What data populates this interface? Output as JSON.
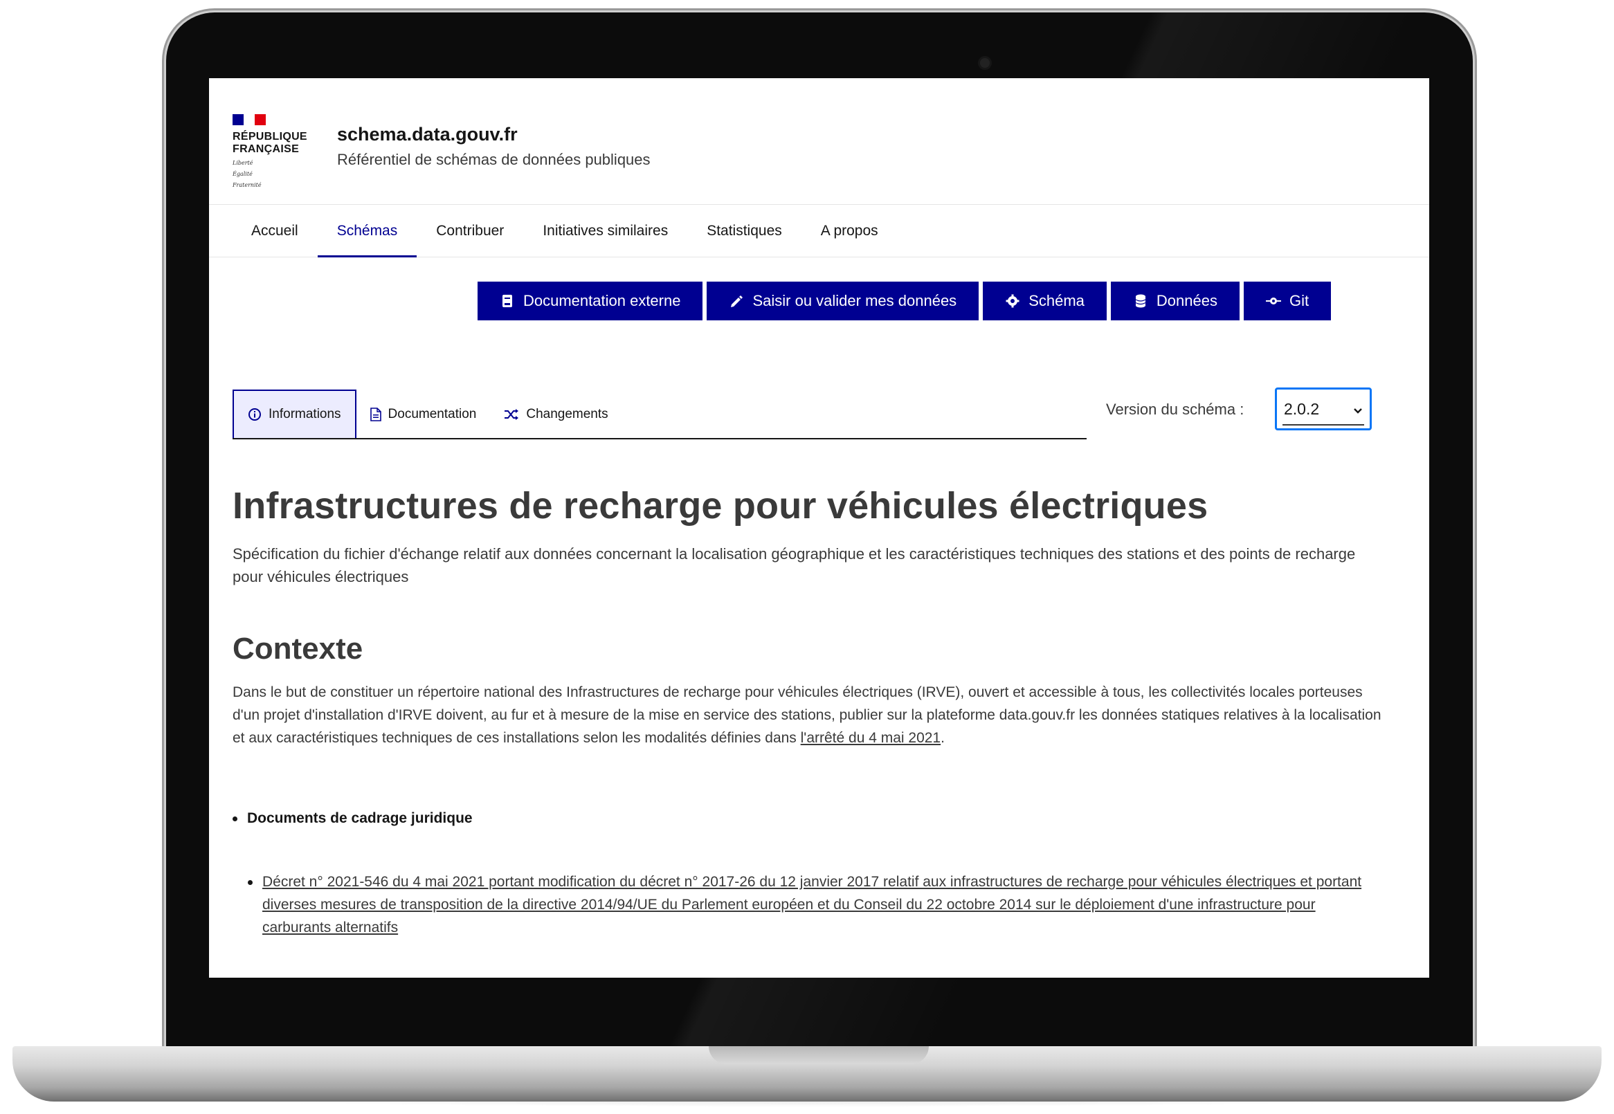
{
  "header": {
    "republic_line1": "RÉPUBLIQUE",
    "republic_line2": "FRANÇAISE",
    "motto_line1": "Liberté",
    "motto_line2": "Égalité",
    "motto_line3": "Fraternité",
    "site_title": "schema.data.gouv.fr",
    "site_tagline": "Référentiel de schémas de données publiques"
  },
  "nav": {
    "items": [
      {
        "label": "Accueil"
      },
      {
        "label": "Schémas",
        "active": true
      },
      {
        "label": "Contribuer"
      },
      {
        "label": "Initiatives similaires"
      },
      {
        "label": "Statistiques"
      },
      {
        "label": "A propos"
      }
    ]
  },
  "actions": [
    {
      "label": "Documentation externe",
      "icon": "document-icon"
    },
    {
      "label": "Saisir ou valider mes données",
      "icon": "pencil-icon"
    },
    {
      "label": "Schéma",
      "icon": "gear-icon"
    },
    {
      "label": "Données",
      "icon": "database-icon"
    },
    {
      "label": "Git",
      "icon": "git-icon"
    }
  ],
  "tabs": [
    {
      "label": "Informations",
      "icon": "info-icon",
      "active": true
    },
    {
      "label": "Documentation",
      "icon": "file-icon"
    },
    {
      "label": "Changements",
      "icon": "shuffle-icon"
    }
  ],
  "version": {
    "label": "Version du schéma :",
    "selected": "2.0.2"
  },
  "content": {
    "title": "Infrastructures de recharge pour véhicules électriques",
    "lead": "Spécification du fichier d'échange relatif aux données concernant la localisation géographique et les caractéristiques techniques des stations et des points de recharge pour véhicules électriques",
    "context_heading": "Contexte",
    "context_text": "Dans le but de constituer un répertoire national des Infrastructures de recharge pour véhicules électriques (IRVE), ouvert et accessible à tous, les collectivités locales porteuses d'un projet d'installation d'IRVE doivent, au fur et à mesure de la mise en service des stations, publier sur la plateforme data.gouv.fr les données statiques relatives à la localisation et aux caractéristiques techniques de ces installations selon les modalités définies dans ",
    "context_link": "l'arrêté du 4 mai 2021",
    "context_end": ".",
    "legal_heading": "Documents de cadrage juridique",
    "legal_link": "Décret n° 2021-546 du 4 mai 2021 portant modification du décret n° 2017-26 du 12 janvier 2017 relatif aux infrastructures de recharge pour véhicules électriques et portant diverses mesures de transposition de la directive 2014/94/UE du Parlement européen et du Conseil du 22 octobre 2014 sur le déploiement d'une infrastructure pour carburants alternatifs"
  },
  "colors": {
    "primary": "#000091",
    "tab_active_bg": "#ececfe",
    "select_focus": "#0a76f6"
  }
}
